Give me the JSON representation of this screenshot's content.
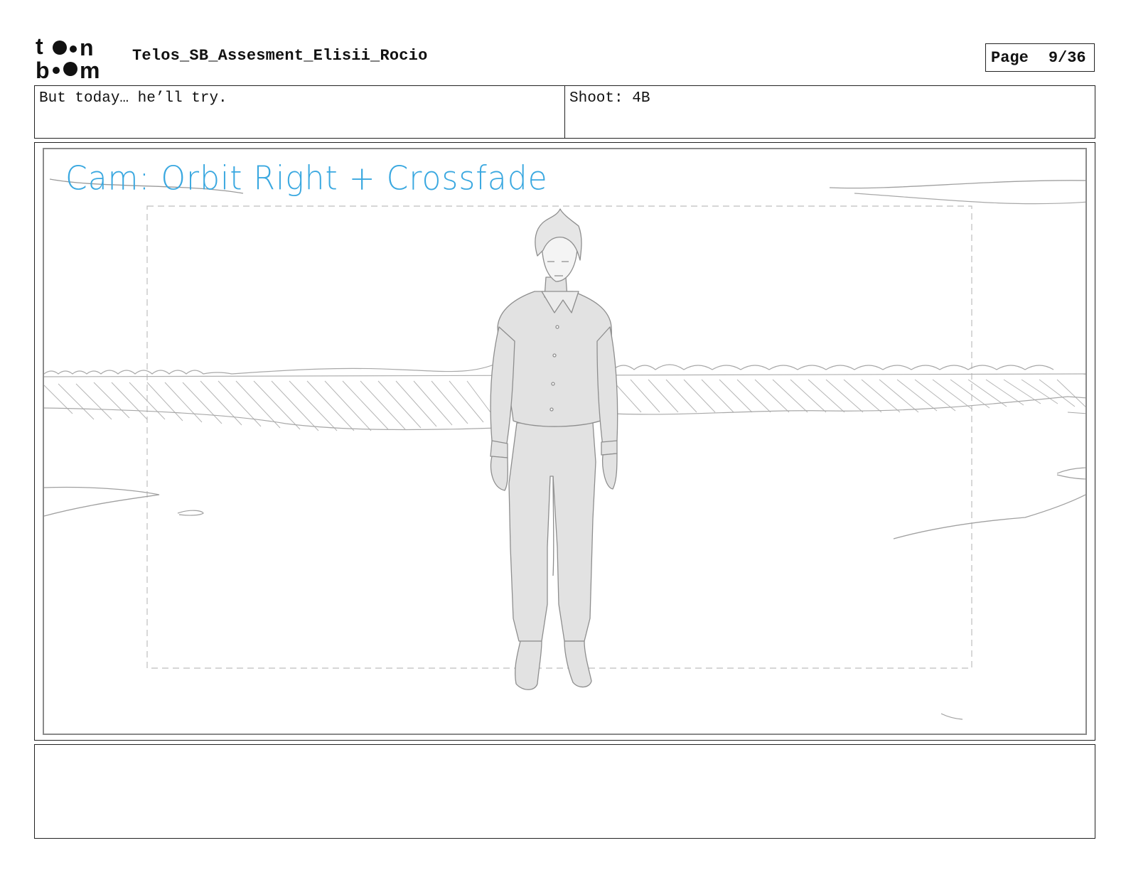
{
  "header": {
    "logo_text": "toon boom",
    "document_title": "Telos_SB_Assesment_Elisii_Rocio",
    "page_label": "Page",
    "page_number": "9/36"
  },
  "info": {
    "dialogue": "But today… he’ll try.",
    "shot": "Shoot: 4B"
  },
  "panel": {
    "camera_note": "Cam: Orbit Right + Crossfade",
    "camera_note_color": "#3aa8e0"
  },
  "notes": {
    "text": ""
  }
}
